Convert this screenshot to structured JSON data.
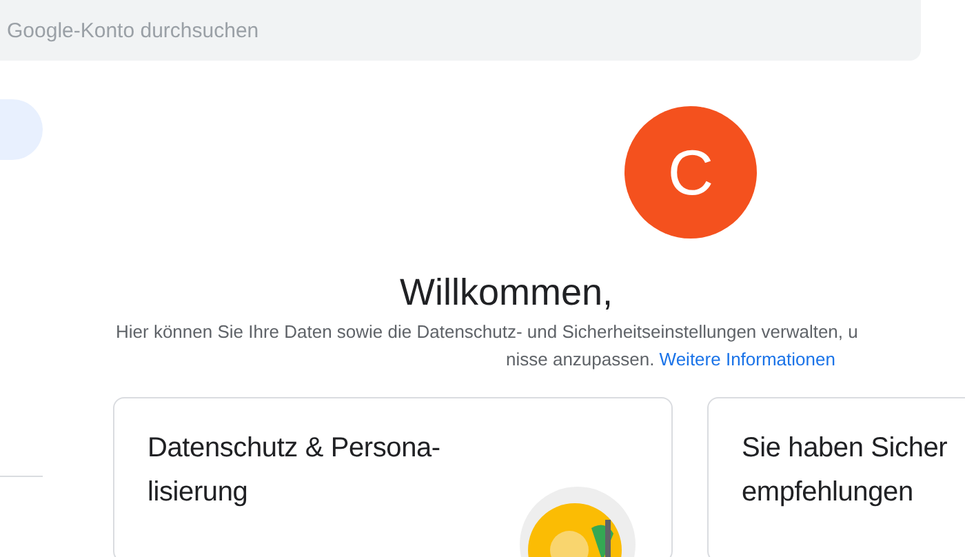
{
  "search": {
    "placeholder": "Google-Konto durchsuchen"
  },
  "avatar": {
    "initial": "C"
  },
  "welcome": {
    "title": "Willkommen,",
    "description_lines": [
      "Hier können Sie Ihre Daten sowie die Datenschutz- und Sicherheitseinstellungen verwalten, u",
      "nisse anzupassen. "
    ],
    "link": "Weitere Informationen"
  },
  "cards": [
    {
      "title_lines": [
        "Datenschutz & Persona-",
        "lisierung"
      ],
      "illustration": true
    },
    {
      "title_lines": [
        "Sie haben Sicher",
        "empfehlungen"
      ]
    }
  ]
}
